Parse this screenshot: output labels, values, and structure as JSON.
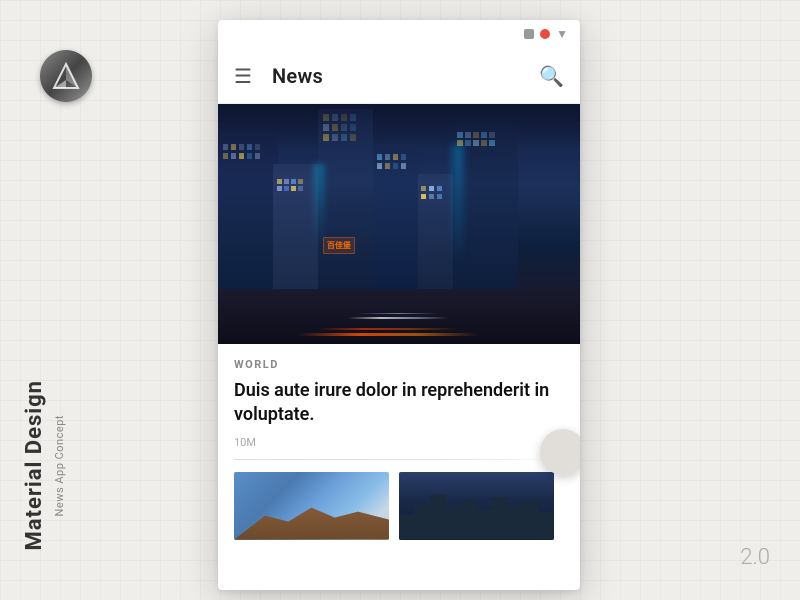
{
  "app": {
    "title": "News",
    "version": "2.0"
  },
  "logo": {
    "alt": "Material Design Logo"
  },
  "side_label": {
    "main": "Material Design",
    "sub": "News App Concept"
  },
  "status_bar": {
    "icons": [
      "square",
      "circle",
      "chevron"
    ]
  },
  "toolbar": {
    "menu_label": "☰",
    "title": "News",
    "search_label": "🔍"
  },
  "hero_article": {
    "category": "WORLD",
    "title": "Duis aute irure dolor in reprehenderit in voluptate.",
    "time": "10M"
  },
  "cards": [
    {
      "type": "landscape",
      "description": "Mountain landscape"
    },
    {
      "type": "city",
      "description": "City skyline"
    }
  ]
}
